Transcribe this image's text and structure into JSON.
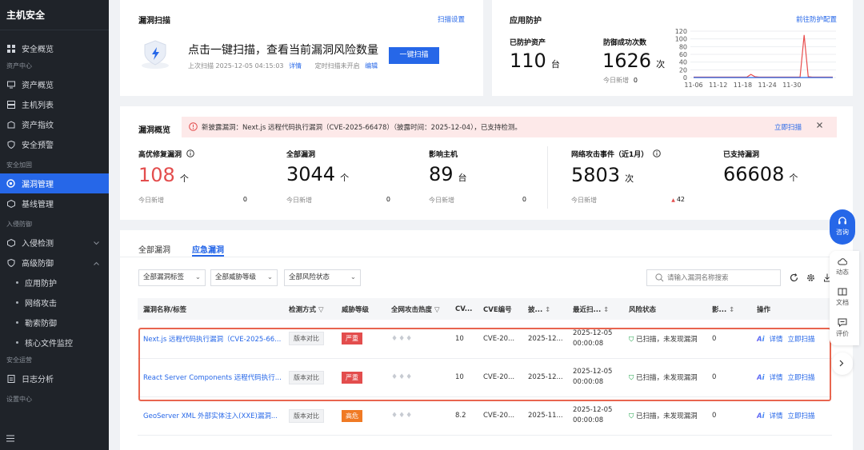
{
  "sidebar": {
    "title": "主机安全",
    "overview": "安全概览",
    "groups": {
      "asset_center": "资产中心",
      "hardening": "安全加固",
      "intrusion": "入侵防御",
      "operations": "安全运营",
      "settings": "设置中心"
    },
    "asset_items": [
      "资产概览",
      "主机列表",
      "资产指纹",
      "安全预警"
    ],
    "hardening_items": [
      "漏洞管理",
      "基线管理"
    ],
    "intrusion_items": [
      "入侵检测",
      "高级防御"
    ],
    "advanced_sub": [
      "应用防护",
      "网络攻击",
      "勒索防御",
      "核心文件监控"
    ],
    "ops_items": [
      "日志分析"
    ]
  },
  "scan_card": {
    "title": "漏洞扫描",
    "settings_link": "扫描设置",
    "headline": "点击一键扫描，查看当前漏洞风险数量",
    "last_scan": "上次扫描 2025-12-05 04:15:03",
    "detail_link": "详情",
    "schedule": "定时扫描未开启",
    "edit_link": "编辑",
    "scan_button": "一键扫描"
  },
  "protect_card": {
    "title": "应用防护",
    "config_link": "前往防护配置",
    "assets_label": "已防护资产",
    "assets_value": "110",
    "assets_unit": "台",
    "success_label": "防御成功次数",
    "success_value": "1626",
    "success_unit": "次",
    "today_label": "今日新增",
    "today_value": "0"
  },
  "chart_data": {
    "type": "line",
    "x": [
      "11-06",
      "11-12",
      "11-18",
      "11-24",
      "11-30"
    ],
    "yticks": [
      "120",
      "100",
      "80",
      "60",
      "40",
      "20",
      "0"
    ],
    "ylim": [
      0,
      120
    ],
    "series": [
      {
        "values": [
          1,
          1,
          1,
          1,
          1,
          1,
          1,
          1,
          1,
          1,
          1,
          1,
          1,
          1,
          8,
          2,
          1,
          1,
          1,
          1,
          1,
          1,
          1,
          1,
          1,
          1,
          1,
          110,
          2,
          1,
          1,
          1,
          1,
          1,
          1
        ],
        "color": "#e84d4d"
      },
      {
        "values": [
          0,
          0,
          0,
          0,
          0,
          0,
          0,
          0,
          0,
          0,
          0,
          0,
          0,
          0,
          0,
          0,
          0,
          0,
          0,
          0,
          0,
          0,
          0,
          0,
          0,
          0,
          0,
          0,
          0,
          0,
          0,
          0,
          0,
          0,
          0
        ],
        "color": "#2667e8"
      }
    ]
  },
  "vuln_overview": {
    "title": "漏洞概览",
    "alert_text": "新披露漏洞：Next.js 远程代码执行漏洞（CVE-2025-66478）（披露时间：2025-12-04），已支持检测。",
    "alert_link": "立即扫描",
    "kpis": [
      {
        "label": "高优修复漏洞",
        "value": "108",
        "unit": "个",
        "sub": "今日新增",
        "sub_value": "0"
      },
      {
        "label": "全部漏洞",
        "value": "3044",
        "unit": "个",
        "sub": "今日新增",
        "sub_value": "0"
      },
      {
        "label": "影响主机",
        "value": "89",
        "unit": "台",
        "sub": "今日新增",
        "sub_value": "0"
      },
      {
        "label": "网络攻击事件（近1月）",
        "value": "5803",
        "unit": "次",
        "sub": "今日新增",
        "sub_value": "42"
      },
      {
        "label": "已支持漏洞",
        "value": "66608",
        "unit": "个"
      }
    ]
  },
  "tabs": [
    "全部漏洞",
    "应急漏洞"
  ],
  "filters": [
    "全部漏洞标签",
    "全部威胁等级",
    "全部风险状态"
  ],
  "search_placeholder": "请输入漏洞名称搜索",
  "table": {
    "headers": [
      "漏洞名称/标签",
      "检测方式",
      "威胁等级",
      "全网攻击热度",
      "CV...",
      "CVE编号",
      "披...",
      "最近扫...",
      "风险状态",
      "影...",
      "操作"
    ],
    "rows": [
      {
        "name": "Next.js 远程代码执行漏洞（CVE-2025-66...",
        "method": "版本对比",
        "level": "严重",
        "cvss": "10",
        "cve": "CVE-20...",
        "disclosed": "2025-12...",
        "scan_date": "2025-12-05",
        "scan_time": "00:00:08",
        "status": "已扫描，未发现漏洞",
        "affected": "0"
      },
      {
        "name": "React Server Components 远程代码执行...",
        "method": "版本对比",
        "level": "严重",
        "cvss": "10",
        "cve": "CVE-20...",
        "disclosed": "2025-12...",
        "scan_date": "2025-12-05",
        "scan_time": "00:00:08",
        "status": "已扫描，未发现漏洞",
        "affected": "0"
      },
      {
        "name": "GeoServer XML 外部实体注入(XXE)漏洞...",
        "method": "版本对比",
        "level": "高危",
        "cvss": "8.2",
        "cve": "CVE-20...",
        "disclosed": "2025-11...",
        "scan_date": "2025-12-05",
        "scan_time": "00:00:08",
        "status": "已扫描，未发现漏洞",
        "affected": "0"
      }
    ],
    "ops": {
      "ai": "Ai",
      "detail": "详情",
      "scan": "立即扫描"
    }
  },
  "float": {
    "consult": "咨询",
    "dynamic": "动态",
    "docs": "文档",
    "review": "评价"
  }
}
